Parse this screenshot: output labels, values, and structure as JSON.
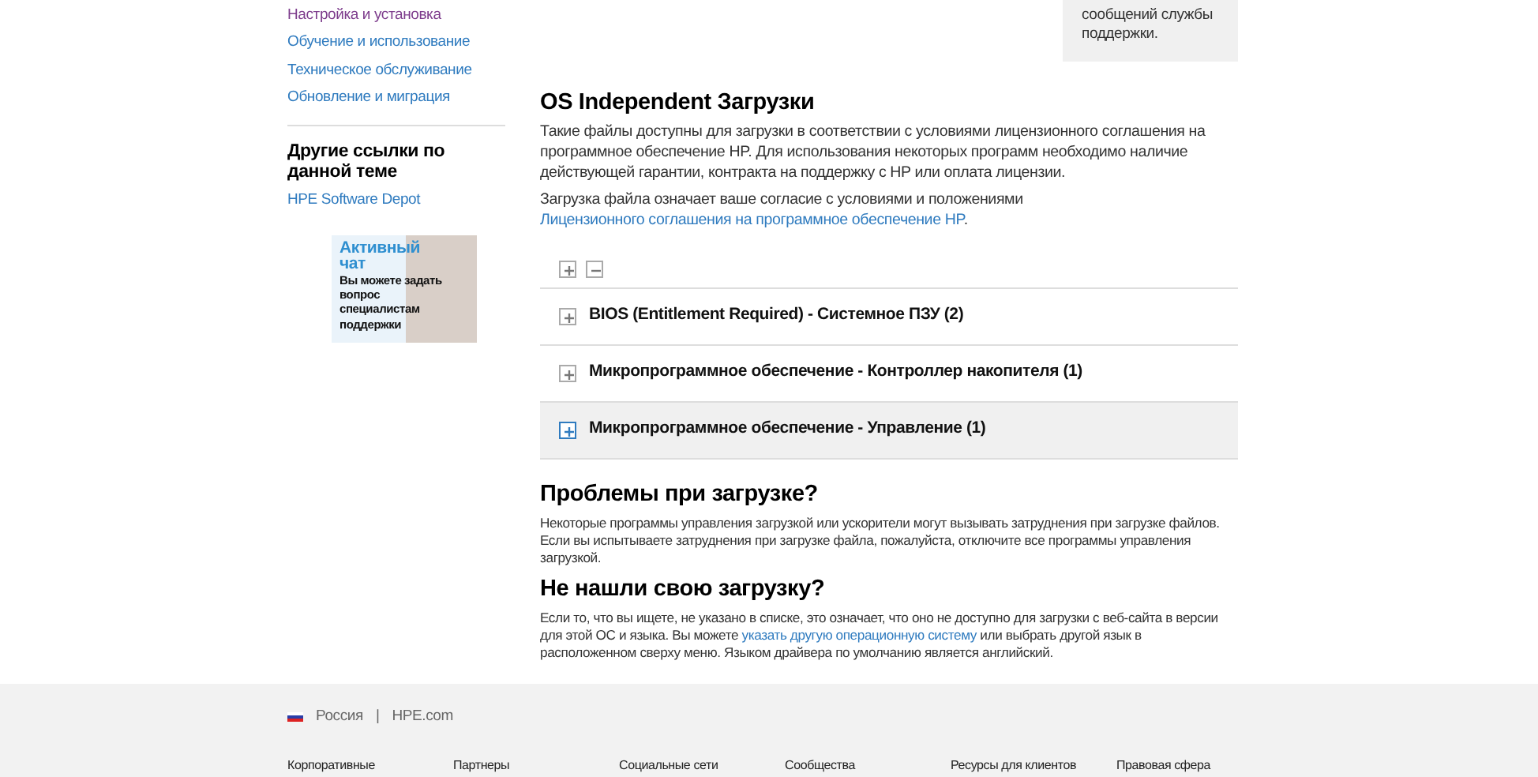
{
  "sidebar": {
    "links": [
      {
        "label": "Настройка и установка",
        "visited": true
      },
      {
        "label": "Обучение и использование",
        "visited": false
      },
      {
        "label": "Техническое обслуживание",
        "visited": false
      },
      {
        "label": "Обновление и миграция",
        "visited": false
      }
    ],
    "other_links_title": "Другие ссылки по данной теме",
    "other_links": [
      "HPE Software Depot"
    ],
    "chat_banner": {
      "title": "Активный чат",
      "text": "Вы можете задать вопрос специалистам поддержки"
    }
  },
  "info_box": {
    "text": "сообщений службы поддержки."
  },
  "main": {
    "title": "OS Independent Загрузки",
    "intro": "Такие файлы доступны для загрузки в соответствии с условиями лицензионного соглашения на программное обеспечение HP. Для использования некоторых программ необходимо наличие действующей гарантии, контракта на поддержку с HP или оплата лицензии.",
    "agreement": {
      "text": "Загрузка файла означает ваше согласие с условиями и положениями ",
      "link": "Лицензионного соглашения на программное обеспечение HP",
      "after": "."
    },
    "sections": [
      {
        "label": "BIOS (Entitlement Required) - Системное ПЗУ (2)",
        "expanded": false,
        "highlighted": false
      },
      {
        "label": "Микропрограммное обеспечение - Контроллер накопителя (1)",
        "expanded": false,
        "highlighted": false
      },
      {
        "label": "Микропрограммное обеспечение - Управление (1)",
        "expanded": false,
        "highlighted": true
      }
    ],
    "problems": {
      "title": "Проблемы при загрузке?",
      "text": "Некоторые программы управления загрузкой или ускорители могут вызывать затруднения при загрузке файлов. Если вы испытываете затруднения при загрузке файла, пожалуйста, отключите все программы управления загрузкой."
    },
    "not_found": {
      "title": "Не нашли свою загрузку?",
      "before": "Если то, что вы ищете, не указано в списке, это означает, что оно не доступно для загрузки с веб-сайта в версии для этой ОС и языка. Вы можете ",
      "link": "указать другую операционную систему",
      "after": " или выбрать другой язык в расположенном сверху меню. Языком драйвера по умолчанию является английский."
    }
  },
  "footer": {
    "country": "Россия",
    "separator": "|",
    "site": "HPE.com",
    "columns": [
      "Корпоративные",
      "Партнеры",
      "Социальные сети",
      "Сообщества",
      "Ресурсы для клиентов",
      "Правовая сфера"
    ]
  }
}
